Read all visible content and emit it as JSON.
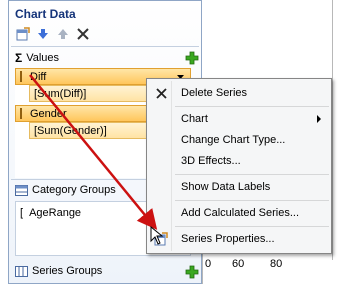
{
  "pane": {
    "title": "Chart Data",
    "values_label": "Values",
    "category_groups_label": "Category Groups",
    "series_groups_label": "Series Groups"
  },
  "values": [
    {
      "name": "Diff",
      "field": "[Sum(Diff)]"
    },
    {
      "name": "Gender",
      "field": "[Sum(Gender)]"
    }
  ],
  "category_groups": [
    "AgeRange"
  ],
  "context_menu": {
    "items": [
      {
        "label": "Delete Series",
        "icon": "close-icon"
      },
      {
        "label": "Chart",
        "submenu": true
      },
      {
        "label": "Change Chart Type..."
      },
      {
        "label": "3D Effects..."
      },
      {
        "label": "Show Data Labels"
      },
      {
        "label": "Add Calculated Series..."
      },
      {
        "label": "Series Properties...",
        "icon": "properties-icon"
      }
    ]
  },
  "axis_ticks": [
    "0",
    "60",
    "80"
  ],
  "colors": {
    "selection_orange": "#ffc65c",
    "annotation_arrow": "#cc1111",
    "add_green": "#3aa820",
    "title_blue": "#15347a"
  }
}
